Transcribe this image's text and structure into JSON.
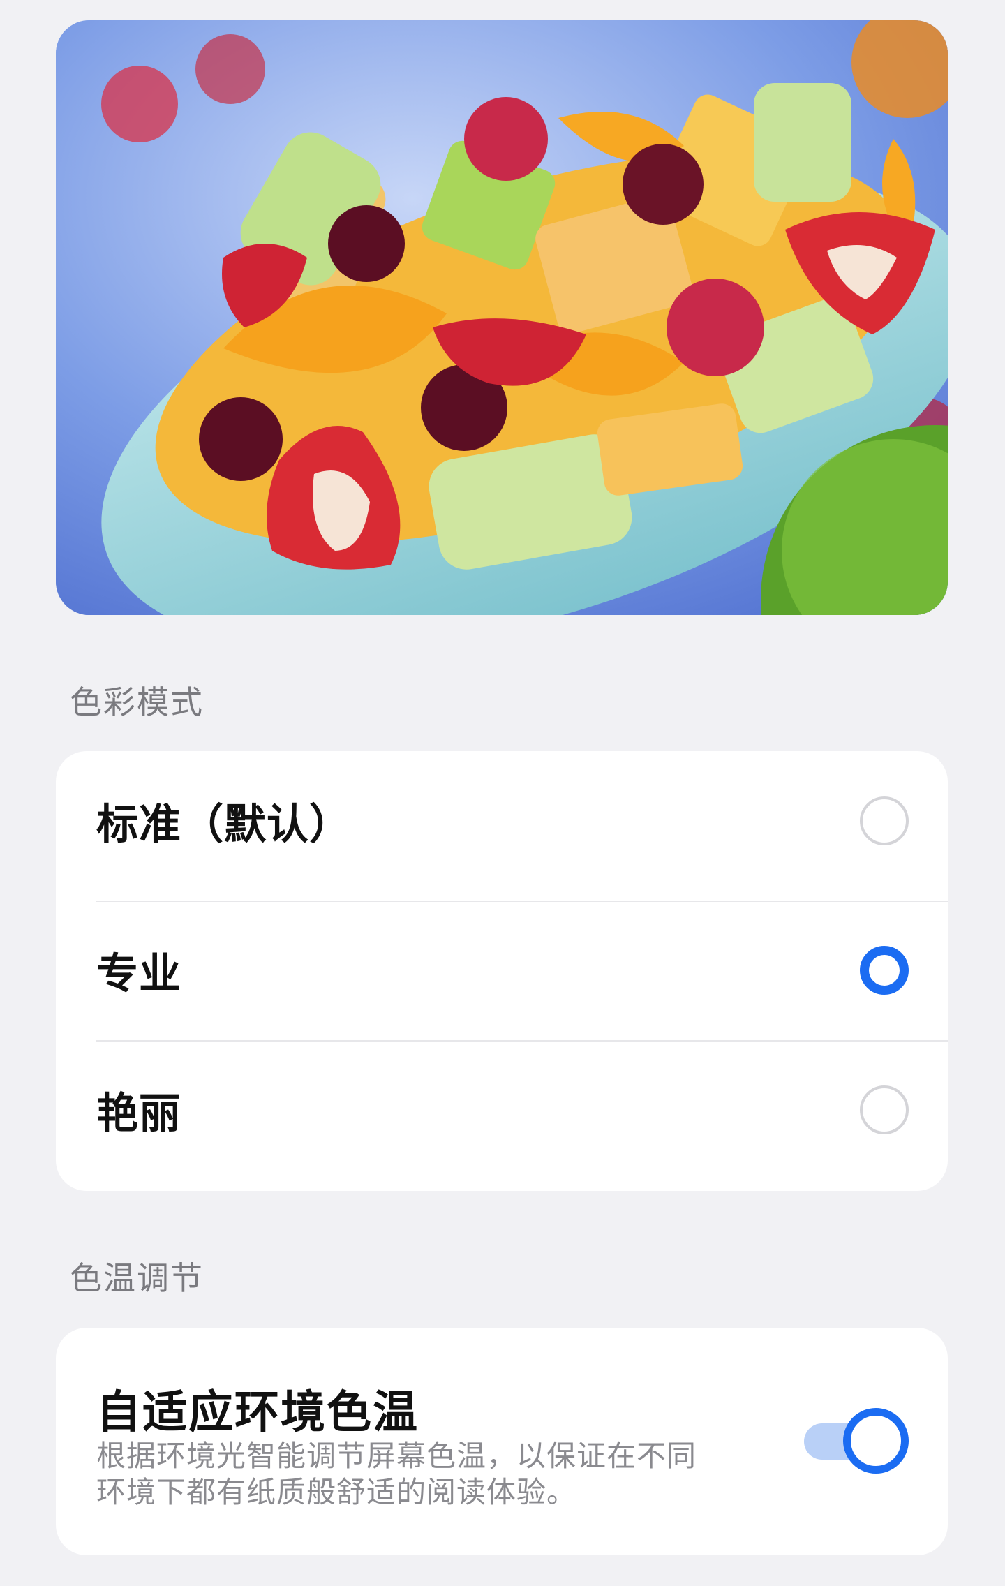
{
  "preview": {
    "image_description": "fruit-salad-bowl"
  },
  "color_mode": {
    "section_title": "色彩模式",
    "options": [
      {
        "label": "标准（默认）",
        "selected": false
      },
      {
        "label": "专业",
        "selected": true
      },
      {
        "label": "艳丽",
        "selected": false
      }
    ]
  },
  "color_temp": {
    "section_title": "色温调节",
    "adaptive": {
      "title": "自适应环境色温",
      "description": "根据环境光智能调节屏幕色温，以保证在不同环境下都有纸质般舒适的阅读体验。",
      "enabled": true
    }
  },
  "colors": {
    "accent": "#1b6cf2",
    "background": "#f1f1f4",
    "card": "#ffffff",
    "toggle_track": "#b9d0f7",
    "secondary_text": "#8a8a8f"
  }
}
